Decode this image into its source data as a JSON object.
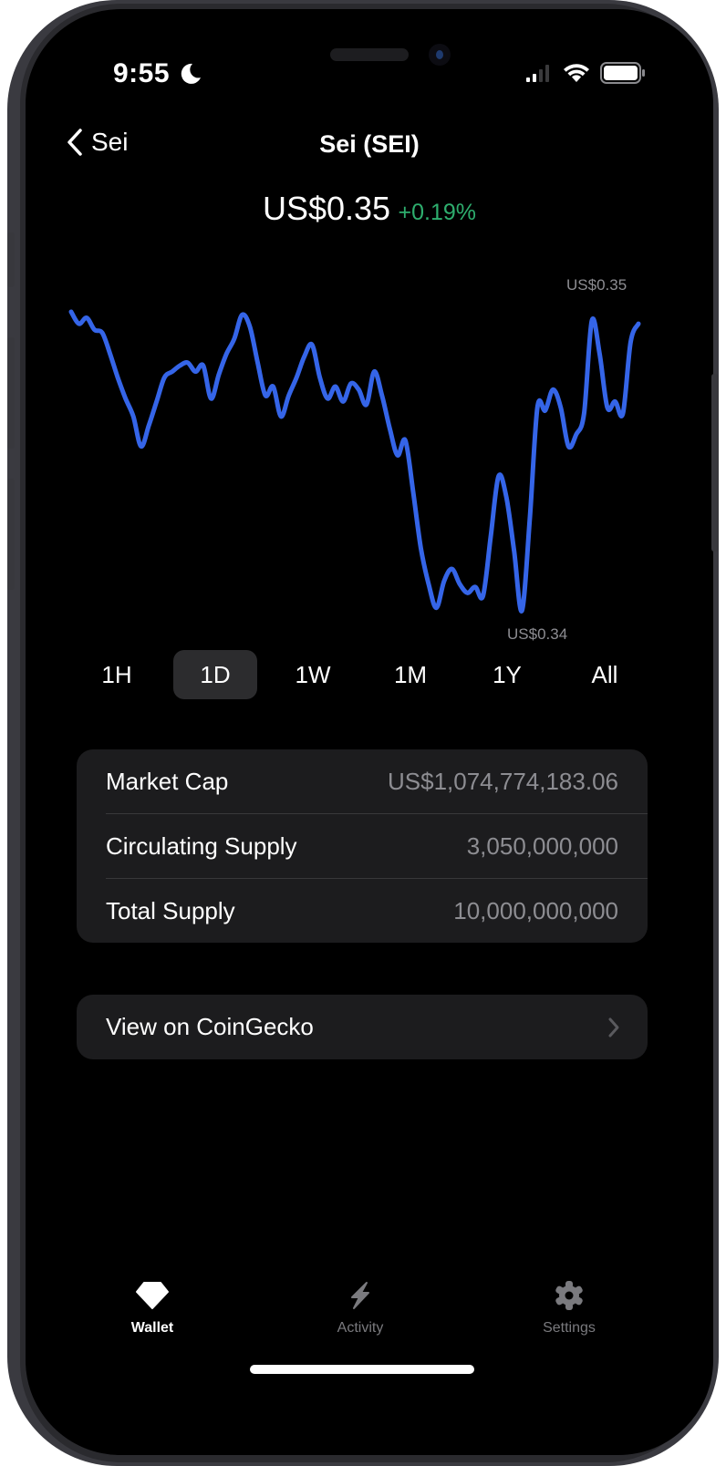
{
  "status_bar": {
    "time": "9:55",
    "focus_icon": "moon-icon",
    "icons": [
      "cellular-signal-icon",
      "wifi-icon",
      "battery-icon"
    ]
  },
  "nav": {
    "back_label": "Sei",
    "back_icon": "chevron-left-icon",
    "title": "Sei (SEI)"
  },
  "price": {
    "value": "US$0.35",
    "change": "+0.19%",
    "change_color": "#2eae6e"
  },
  "chart_data": {
    "type": "line",
    "title": "",
    "xlabel": "",
    "ylabel": "",
    "line_color": "#3565e8",
    "max_label": "US$0.35",
    "min_label": "US$0.34",
    "ylim": [
      0.34,
      0.35
    ],
    "grid": false,
    "values": [
      0.35,
      0.3496,
      0.3498,
      0.3494,
      0.3493,
      0.3486,
      0.3478,
      0.3471,
      0.3465,
      0.3455,
      0.3462,
      0.347,
      0.3478,
      0.348,
      0.3482,
      0.3483,
      0.348,
      0.3482,
      0.3471,
      0.3479,
      0.3486,
      0.3491,
      0.3499,
      0.3495,
      0.3483,
      0.3472,
      0.3475,
      0.3465,
      0.3472,
      0.3478,
      0.3485,
      0.3489,
      0.3478,
      0.3471,
      0.3475,
      0.347,
      0.3476,
      0.3474,
      0.3469,
      0.348,
      0.3472,
      0.3461,
      0.3452,
      0.3457,
      0.344,
      0.3421,
      0.3409,
      0.3401,
      0.341,
      0.3414,
      0.3409,
      0.3406,
      0.3408,
      0.3405,
      0.3425,
      0.3445,
      0.3438,
      0.342,
      0.34,
      0.343,
      0.3468,
      0.3467,
      0.3474,
      0.3468,
      0.3455,
      0.3459,
      0.3466,
      0.3497,
      0.3486,
      0.3468,
      0.347,
      0.3466,
      0.349,
      0.3496
    ]
  },
  "ranges": {
    "items": [
      "1H",
      "1D",
      "1W",
      "1M",
      "1Y",
      "All"
    ],
    "selected": "1D"
  },
  "stats": {
    "rows": [
      {
        "label": "Market Cap",
        "value": "US$1,074,774,183.06"
      },
      {
        "label": "Circulating Supply",
        "value": "3,050,000,000"
      },
      {
        "label": "Total Supply",
        "value": "10,000,000,000"
      }
    ]
  },
  "link": {
    "label": "View on CoinGecko",
    "icon": "chevron-right-icon"
  },
  "tabbar": {
    "items": [
      {
        "label": "Wallet",
        "icon": "diamond-icon",
        "active": true
      },
      {
        "label": "Activity",
        "icon": "bolt-icon",
        "active": false
      },
      {
        "label": "Settings",
        "icon": "gear-icon",
        "active": false
      }
    ],
    "active_color": "#ffffff",
    "inactive_color": "#7a7a7e"
  }
}
